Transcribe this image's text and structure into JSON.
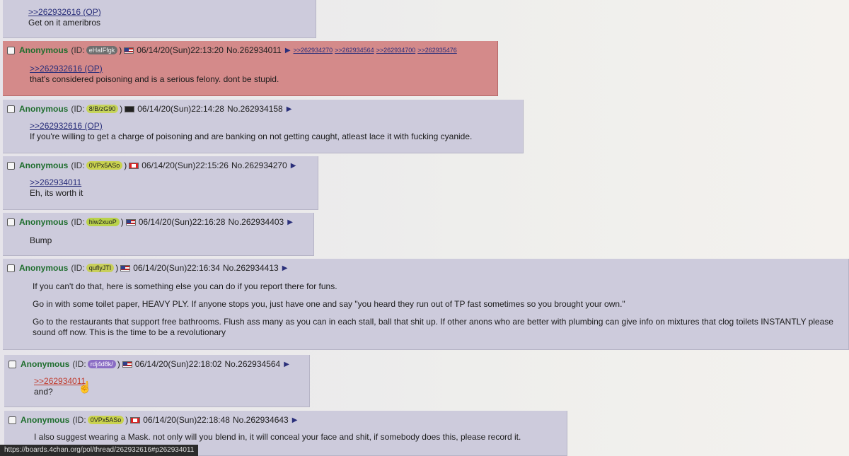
{
  "posts": [
    {
      "quotes": [
        ">>262932616 (OP)"
      ],
      "lines": [
        "Get on it ameribros"
      ]
    },
    {
      "name": "Anonymous",
      "id_label": "(ID:",
      "id": "eHaIFfgk",
      "id_color": "#6e6e6e",
      "flag": "us-flag",
      "datetime": "06/14/20(Sun)22:13:20",
      "no": "No.262934011",
      "backlinks": [
        ">>262934270",
        ">>262934564",
        ">>262934700",
        ">>262935476"
      ],
      "quotes": [
        ">>262932616 (OP)"
      ],
      "lines": [
        "that's considered poisoning and is a serious felony. dont be stupid."
      ]
    },
    {
      "name": "Anonymous",
      "id_label": "(ID:",
      "id": "8/B/zG90",
      "id_color": "#c6d45a",
      "flag": "dark-flag",
      "datetime": "06/14/20(Sun)22:14:28",
      "no": "No.262934158",
      "quotes": [
        ">>262932616 (OP)"
      ],
      "lines": [
        "If you're willing to get a charge of poisoning and are banking on not getting caught, atleast lace it with fucking cyanide."
      ]
    },
    {
      "name": "Anonymous",
      "id_label": "(ID:",
      "id": "0VPx5ASo",
      "id_color": "#c9d24e",
      "flag": "ca-flag",
      "datetime": "06/14/20(Sun)22:15:26",
      "no": "No.262934270",
      "quotes": [
        ">>262934011"
      ],
      "lines": [
        "Eh, its worth it"
      ]
    },
    {
      "name": "Anonymous",
      "id_label": "(ID:",
      "id": "hiw2xuoP",
      "id_color": "#b9d24a",
      "flag": "us-flag",
      "datetime": "06/14/20(Sun)22:16:28",
      "no": "No.262934403",
      "lines": [
        "Bump"
      ]
    },
    {
      "name": "Anonymous",
      "id_label": "(ID:",
      "id": "quflyJTI",
      "id_color": "#c8cf5a",
      "flag": "us-flag",
      "datetime": "06/14/20(Sun)22:16:34",
      "no": "No.262934413",
      "paragraphs": [
        "If you can't do that, here is something else you can do if you report there for funs.",
        "Go in with some toilet paper, HEAVY PLY. If anyone stops you, just have one and say \"you heard they run out of TP fast sometimes so you brought your own.\"",
        "Go to the restaurants that support free bathrooms. Flush ass many as you can in each stall, ball that shit up. If other anons who are better with plumbing can give info on mixtures that clog toilets INSTANTLY please sound off now. This is the time to be a revolutionary"
      ]
    },
    {
      "name": "Anonymous",
      "id_label": "(ID:",
      "id": "rdj4d8k/",
      "id_color": "#8a6cc4",
      "flag": "us-flag",
      "datetime": "06/14/20(Sun)22:18:02",
      "no": "No.262934564",
      "quotes": [
        ">>262934011"
      ],
      "lines": [
        "and?"
      ]
    },
    {
      "name": "Anonymous",
      "id_label": "(ID:",
      "id": "0VPx5ASo",
      "id_color": "#c9d24e",
      "flag": "ca-flag",
      "datetime": "06/14/20(Sun)22:18:48",
      "no": "No.262934643",
      "lines": [
        "I also suggest wearing a Mask. not only will you blend in, it will conceal your face and shit, if somebody does this, please record it."
      ]
    }
  ],
  "status_url": "https://boards.4chan.org/pol/thread/262932616#p262934011"
}
